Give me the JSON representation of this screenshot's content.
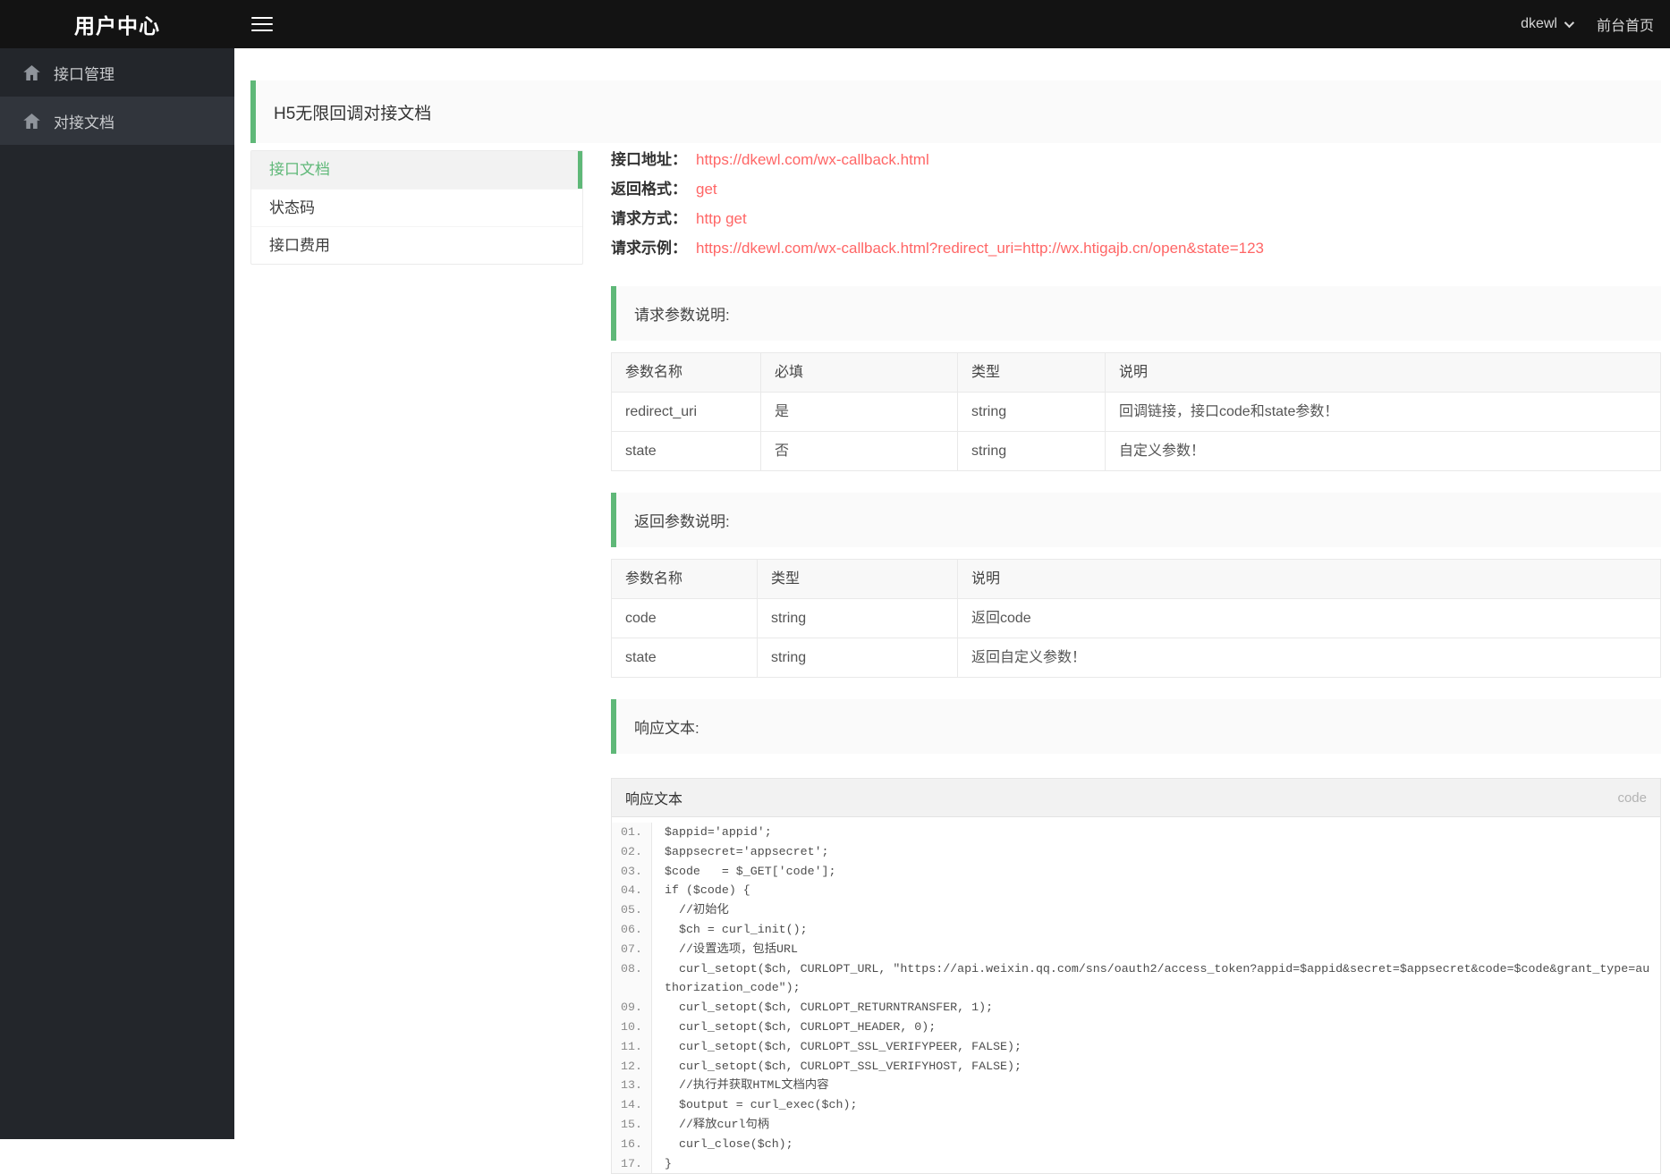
{
  "colors": {
    "accent_green": "#5FB878",
    "accent_red": "#ff6666",
    "navbar_bg": "#131313",
    "sidebar_bg": "#23262b"
  },
  "navbar": {
    "title": "用户中心",
    "user": "dkewl",
    "home_link": "前台首页"
  },
  "sidebar": {
    "items": [
      {
        "label": "接口管理",
        "icon": "home",
        "active": false
      },
      {
        "label": "对接文档",
        "icon": "home",
        "active": true
      }
    ]
  },
  "page": {
    "header_title": "H5无限回调对接文档"
  },
  "submenu": {
    "items": [
      {
        "label": "接口文档",
        "active": true
      },
      {
        "label": "状态码",
        "active": false
      },
      {
        "label": "接口费用",
        "active": false
      }
    ]
  },
  "api_info": {
    "rows": [
      {
        "label": "接口地址：",
        "value": "https://dkewl.com/wx-callback.html"
      },
      {
        "label": "返回格式：",
        "value": "get"
      },
      {
        "label": "请求方式：",
        "value": "http get"
      },
      {
        "label": "请求示例：",
        "value": "https://dkewl.com/wx-callback.html?redirect_uri=http://wx.htigajb.cn/open&state=123"
      }
    ]
  },
  "request_params": {
    "title": "请求参数说明:",
    "headers": [
      "参数名称",
      "必填",
      "类型",
      "说明"
    ],
    "rows": [
      [
        "redirect_uri",
        "是",
        "string",
        "回调链接，接口code和state参数！"
      ],
      [
        "state",
        "否",
        "string",
        "自定义参数！"
      ]
    ]
  },
  "response_params": {
    "title": "返回参数说明:",
    "headers": [
      "参数名称",
      "类型",
      "说明"
    ],
    "rows": [
      [
        "code",
        "string",
        "返回code"
      ],
      [
        "state",
        "string",
        "返回自定义参数！"
      ]
    ]
  },
  "response_text": {
    "title": "响应文本:",
    "panel_title": "响应文本",
    "panel_badge": "code",
    "code_lines": [
      {
        "n": "01.",
        "c": "$appid='appid';"
      },
      {
        "n": "02.",
        "c": "$appsecret='appsecret';"
      },
      {
        "n": "03.",
        "c": "$code   = $_GET['code'];"
      },
      {
        "n": "04.",
        "c": "if ($code) {"
      },
      {
        "n": "05.",
        "c": "  //初始化"
      },
      {
        "n": "06.",
        "c": "  $ch = curl_init();"
      },
      {
        "n": "07.",
        "c": "  //设置选项，包括URL"
      },
      {
        "n": "08.",
        "c": "  curl_setopt($ch, CURLOPT_URL, \"https://api.weixin.qq.com/sns/oauth2/access_token?appid=$appid&secret=$appsecret&code=$code&grant_type=authorization_code\");"
      },
      {
        "n": "09.",
        "c": "  curl_setopt($ch, CURLOPT_RETURNTRANSFER, 1);"
      },
      {
        "n": "10.",
        "c": "  curl_setopt($ch, CURLOPT_HEADER, 0);"
      },
      {
        "n": "11.",
        "c": "  curl_setopt($ch, CURLOPT_SSL_VERIFYPEER, FALSE);"
      },
      {
        "n": "12.",
        "c": "  curl_setopt($ch, CURLOPT_SSL_VERIFYHOST, FALSE);"
      },
      {
        "n": "13.",
        "c": "  //执行并获取HTML文档内容"
      },
      {
        "n": "14.",
        "c": "  $output = curl_exec($ch);"
      },
      {
        "n": "15.",
        "c": "  //释放curl句柄"
      },
      {
        "n": "16.",
        "c": "  curl_close($ch);"
      },
      {
        "n": "17.",
        "c": "}"
      }
    ]
  }
}
